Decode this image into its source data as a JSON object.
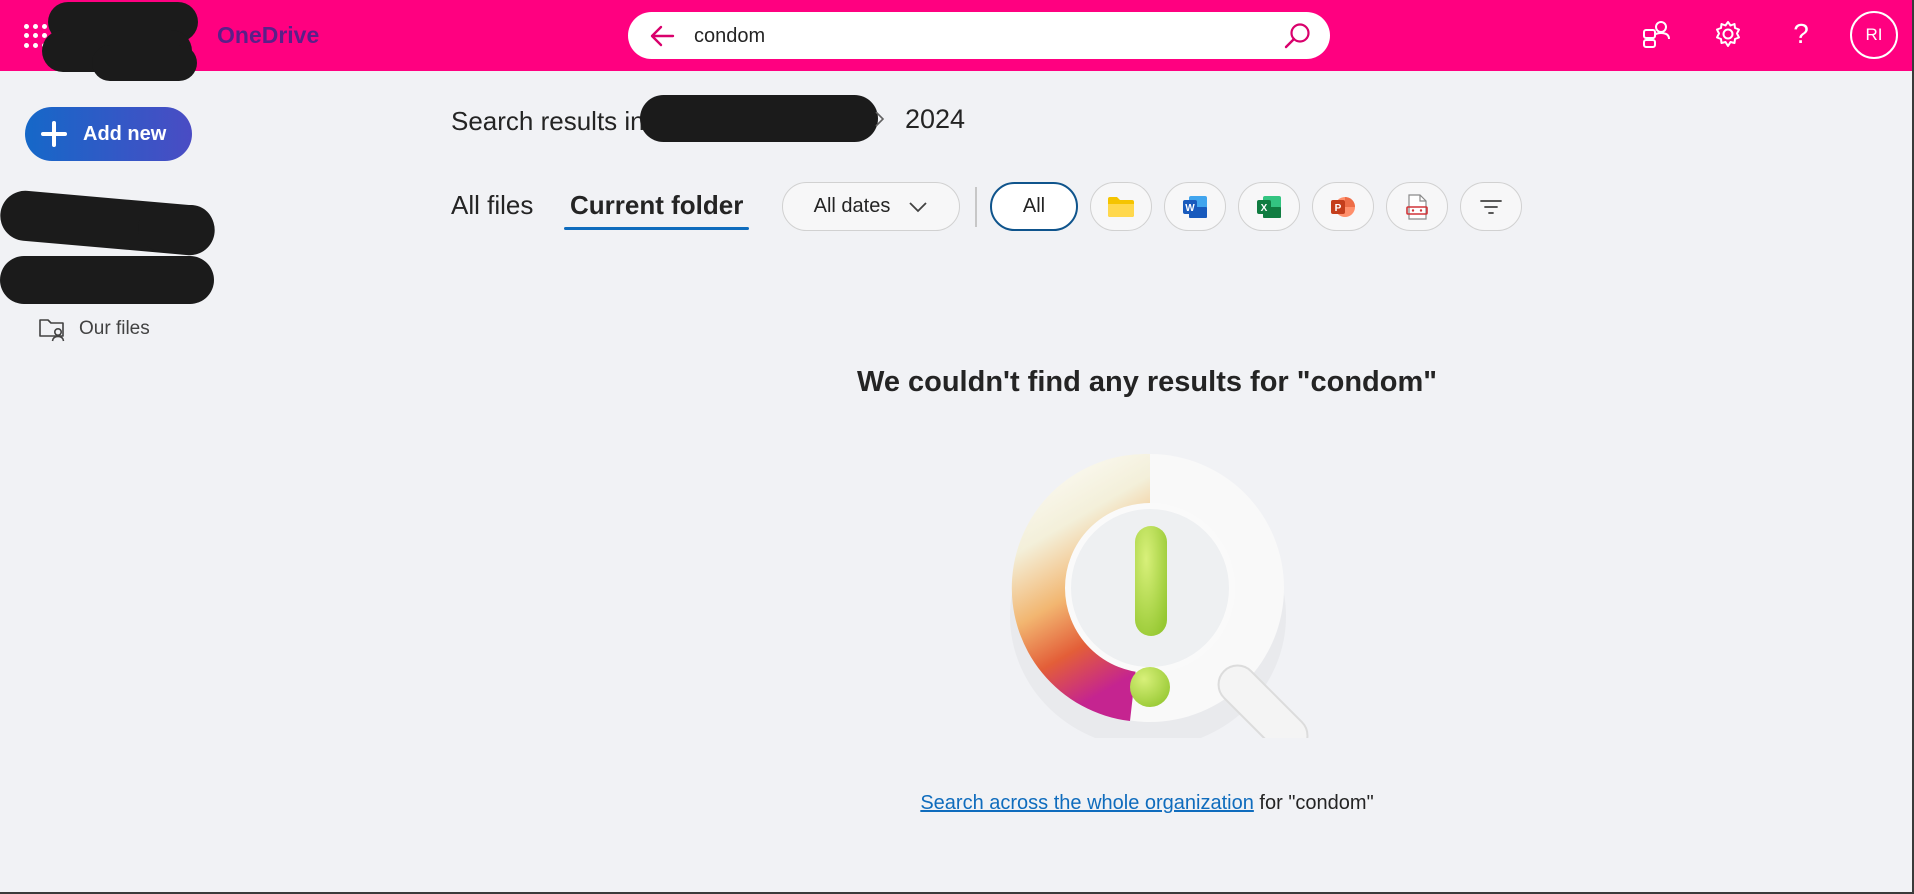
{
  "app": {
    "name": "OneDrive",
    "brand_color": "#ff0080"
  },
  "search": {
    "query": "condom"
  },
  "user": {
    "initials": "RI"
  },
  "sidebar": {
    "add_new_label": "Add new",
    "items": [
      {
        "label": "Our files",
        "icon": "shared-folder-icon"
      }
    ]
  },
  "header": {
    "results_prefix": "Search results in",
    "folder": "2024"
  },
  "tabs": [
    {
      "label": "All files",
      "selected": false
    },
    {
      "label": "Current folder",
      "selected": true
    }
  ],
  "filters": {
    "date_label": "All dates",
    "type_all_label": "All",
    "type_buttons": [
      "folder-icon",
      "word-icon",
      "excel-icon",
      "powerpoint-icon",
      "pdf-icon",
      "filter-icon"
    ]
  },
  "empty_state": {
    "title": "We couldn't find any results for \"condom\"",
    "link_text": "Search across the whole organization",
    "link_suffix": " for \"condom\""
  }
}
